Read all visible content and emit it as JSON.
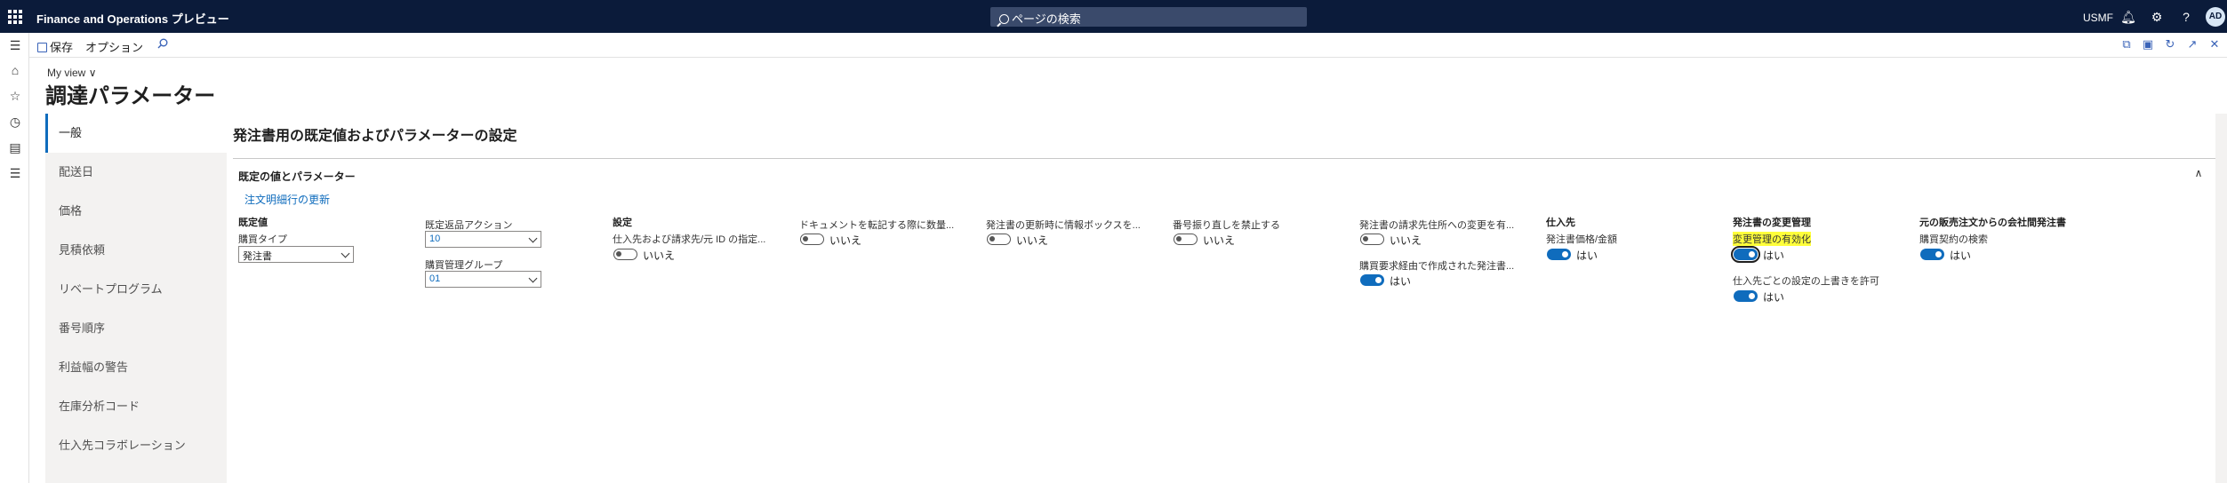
{
  "topbar": {
    "app_title": "Finance and Operations プレビュー",
    "search_placeholder": "ページの検索",
    "company": "USMF",
    "avatar_initials": "AD"
  },
  "action_pane": {
    "save_label": "保存",
    "options_label": "オプション"
  },
  "header": {
    "view_label": "My view",
    "page_title": "調達パラメーター"
  },
  "tabs": [
    {
      "label": "一般",
      "active": true
    },
    {
      "label": "配送日"
    },
    {
      "label": "価格"
    },
    {
      "label": "見積依頼"
    },
    {
      "label": "リベートプログラム"
    },
    {
      "label": "番号順序"
    },
    {
      "label": "利益幅の警告"
    },
    {
      "label": "在庫分析コード"
    },
    {
      "label": "仕入先コラボレーション"
    }
  ],
  "main": {
    "section_title": "発注書用の既定値およびパラメーターの設定",
    "fasttab_title": "既定の値とパラメーター",
    "update_link": "注文明細行の更新",
    "defaults": {
      "group": "既定値",
      "purchase_type_label": "購買タイプ",
      "purchase_type_value": "発注書",
      "return_action_label": "既定返品アクション",
      "return_action_value": "10",
      "purchase_group_label": "購買管理グループ",
      "purchase_group_value": "01"
    },
    "settings": {
      "group": "設定",
      "vendor_invoice_label": "仕入先および請求先/元 ID の指定...",
      "vendor_invoice_value": "いいえ",
      "doc_transfer_label": "ドキュメントを転記する際に数量...",
      "doc_transfer_value": "いいえ",
      "infobox_label": "発注書の更新時に情報ボックスを...",
      "infobox_value": "いいえ",
      "number_reuse_label": "番号振り直しを禁止する",
      "number_reuse_value": "いいえ",
      "invoice_address_label": "発注書の請求先住所への変更を有...",
      "invoice_address_value": "いいえ",
      "requisition_label": "購買要求経由で作成された発注書...",
      "requisition_value": "はい"
    },
    "vendor": {
      "group": "仕入先",
      "price_amount_label": "発注書価格/金額",
      "price_amount_value": "はい"
    },
    "change_management": {
      "group": "発注書の変更管理",
      "enable_label": "変更管理の有効化",
      "enable_value": "はい",
      "override_label": "仕入先ごとの設定の上書きを許可",
      "override_value": "はい"
    },
    "intercompany": {
      "group": "元の販売注文からの会社間発注書",
      "agreement_search_label": "購買契約の検索",
      "agreement_search_value": "はい"
    }
  }
}
